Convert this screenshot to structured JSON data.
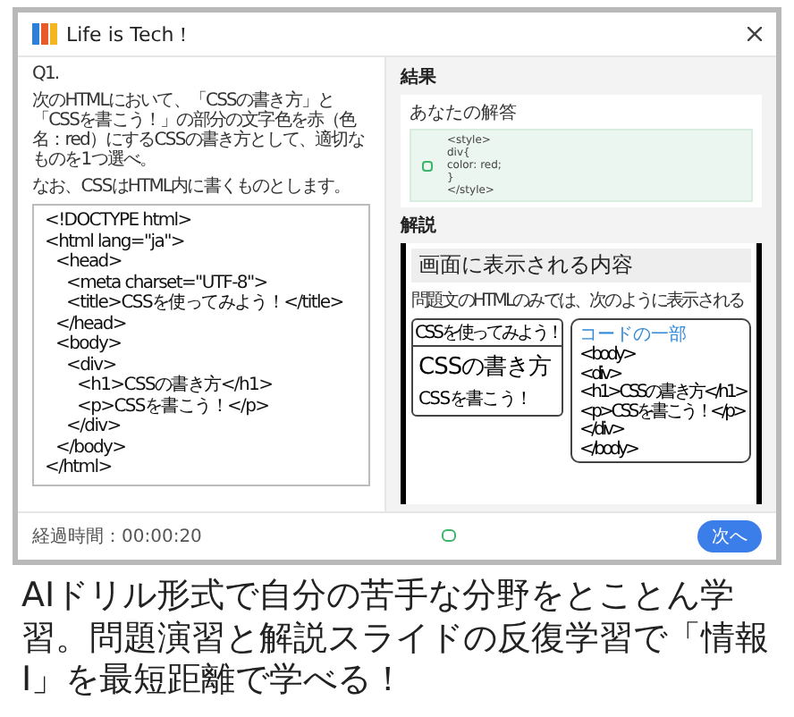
{
  "app": {
    "logo_text": "Life is Tech！"
  },
  "question": {
    "number": "Q1.",
    "lines": [
      "次のHTMLにおいて、「CSSの書き方」と「CSSを書こう！」の部分の文字色を赤（色名：red）にするCSSの書き方として、適切なものを1つ選べ。",
      "なお、CSSはHTML内に書くものとします。"
    ],
    "code": [
      {
        "text": "<!DOCTYPE html>"
      },
      {
        "text": "<html lang=\"ja\">",
        "children": [
          {
            "text": "<head>",
            "children": [
              {
                "text": "<meta charset=\"UTF-8\">"
              },
              {
                "text": "<title>CSSを使ってみよう！</title>"
              }
            ]
          },
          {
            "text": "</head>"
          },
          {
            "text": "<body>",
            "children": [
              {
                "text": "<div>",
                "children": [
                  {
                    "text": "<h1>CSSの書き方</h1>"
                  },
                  {
                    "text": "<p>CSSを書こう！</p>"
                  }
                ]
              },
              {
                "text": "</div>"
              }
            ]
          },
          {
            "text": "</body>"
          }
        ]
      },
      {
        "text": "</html>"
      }
    ]
  },
  "result": {
    "heading": "結果",
    "card_label": "あなたの解答",
    "answer_lines": [
      "<style>",
      "div{",
      "color: red;",
      "}",
      "</style>"
    ]
  },
  "explanation": {
    "heading": "解説",
    "slide": {
      "title": "画面に表示される内容",
      "subtitle": "問題文のHTMLのみでは、次のように表示される",
      "window_title": "CSSを使ってみよう！",
      "page_heading": "CSSの書き方",
      "page_text": "CSSを書こう！",
      "callout_label": "コードの一部",
      "callout_lines": [
        "<body>",
        "<div>",
        "<h1>CSSの書き方</h1>",
        "<p>CSSを書こう！</p>",
        "</div>",
        "</body>"
      ]
    }
  },
  "footer": {
    "elapsed_label": "経過時間：00:00:20",
    "next_button": "次へ"
  },
  "caption": "AIドリル形式で自分の苦手な分野をとことん学習。問題演習と解説スライドの反復学習で「情報Ⅰ」を最短距離で学べる！"
}
